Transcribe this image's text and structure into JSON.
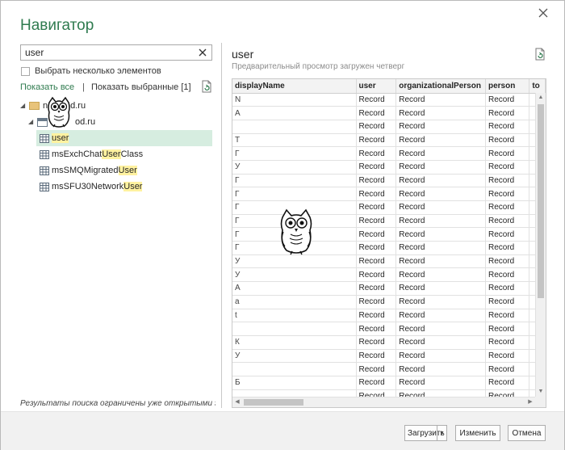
{
  "dialog": {
    "title": "Навигатор"
  },
  "search": {
    "value": "user",
    "placeholder": ""
  },
  "multi_select": {
    "label": "Выбрать несколько элементов",
    "checked": false
  },
  "view_links": {
    "show_all": "Показать все",
    "separator": "|",
    "show_selected": "Показать выбранные [1]"
  },
  "tree": {
    "root_visible_text": "n",
    "root_suffix": "d.ru",
    "child_prefix": "",
    "child_suffix": "od.ru",
    "items": [
      {
        "pre": "",
        "hl": "user",
        "post": "",
        "selected": true
      },
      {
        "pre": "msExchChat",
        "hl": "User",
        "post": "Class",
        "selected": false
      },
      {
        "pre": "msSMQMigrated",
        "hl": "User",
        "post": "",
        "selected": false
      },
      {
        "pre": "msSFU30Network",
        "hl": "User",
        "post": "",
        "selected": false
      }
    ]
  },
  "left_status": "Результаты поиска ограничены уже открытыми э...",
  "preview": {
    "title": "user",
    "subtitle": "Предварительный просмотр загружен четверг"
  },
  "grid": {
    "columns": [
      "displayName",
      "user",
      "organizationalPerson",
      "person",
      "to"
    ],
    "display_fragments": [
      "N",
      "A",
      "",
      "T",
      "Г",
      "У",
      "Г",
      "Г",
      "Г",
      "Г",
      "Г",
      "Г",
      "У",
      "У",
      "А",
      "а",
      "t",
      "",
      "К",
      "У",
      "",
      "Б"
    ],
    "rows_count": 23,
    "cell_value": "Record"
  },
  "footer": {
    "load_label": "Загрузить",
    "edit_label": "Изменить",
    "cancel_label": "Отмена"
  },
  "colors": {
    "accent": "#2f7b4f",
    "selection": "#d6ede0",
    "highlight": "#fff2a0"
  }
}
